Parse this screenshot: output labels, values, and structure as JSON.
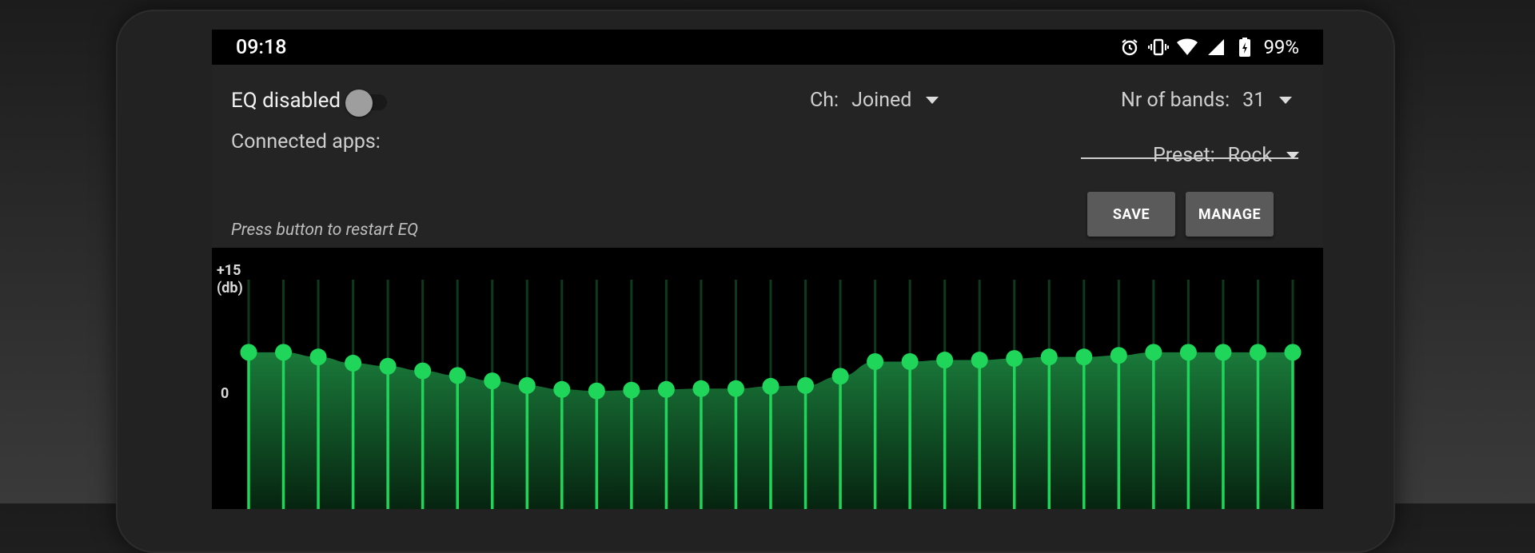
{
  "status_bar": {
    "time": "09:18",
    "icons": [
      "alarm-icon",
      "vibrate-icon",
      "wifi-icon",
      "signal-icon",
      "battery-icon"
    ],
    "battery": "99%"
  },
  "eq": {
    "toggle_label": "EQ disabled",
    "enabled": false,
    "connected_apps_label": "Connected apps:",
    "restart_hint": "Press button to restart EQ"
  },
  "channel": {
    "label": "Ch:",
    "value": "Joined"
  },
  "bands": {
    "label": "Nr of bands:",
    "value": "31"
  },
  "preset": {
    "label": "Preset:",
    "value": "Rock"
  },
  "buttons": {
    "save": "SAVE",
    "manage": "MANAGE"
  },
  "graph": {
    "top_label_line1": "+15",
    "top_label_line2": "(db)",
    "mid_label": "0",
    "accent": "#1fd65a",
    "fill_top": "#1a7a3a",
    "fill_bottom": "#05200e",
    "range_db": [
      -15,
      15
    ],
    "band_gains_db": [
      5.6,
      5.6,
      5.0,
      4.2,
      3.8,
      3.2,
      2.6,
      1.9,
      1.3,
      0.8,
      0.6,
      0.7,
      0.8,
      0.9,
      0.9,
      1.2,
      1.3,
      2.5,
      4.4,
      4.4,
      4.6,
      4.6,
      4.8,
      5.0,
      5.0,
      5.2,
      5.6,
      5.6,
      5.6,
      5.6,
      5.6
    ]
  }
}
